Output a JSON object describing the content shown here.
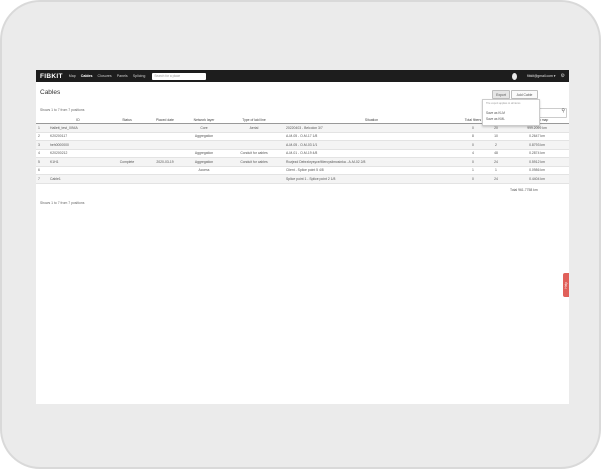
{
  "nav": {
    "logo": "FIBKIT",
    "items": [
      "Map",
      "Cables",
      "Closures",
      "Panels",
      "Splicing"
    ],
    "search_placeholder": "Search for a place",
    "user_email": "fibkit@gmail.com ▾"
  },
  "page": {
    "title": "Cables",
    "export_label": "Export",
    "add_label": "Add Cable",
    "export_menu": {
      "note": "The export applies to all items",
      "items": [
        "Save as KLM",
        "Save as KML"
      ]
    },
    "showing_top": "Shows 1 to 7 from 7 positions",
    "showing_bottom": "Shows 1 to 7 from 7 positions"
  },
  "table": {
    "columns": [
      "ID",
      "Status",
      "Placed date",
      "Network layer",
      "Type of laid line",
      "Situation",
      "Total fibers",
      "Fr",
      "Length on map"
    ],
    "rows": [
      {
        "n": "1",
        "id": "Hallett_test_XINIA",
        "status": "",
        "date": "",
        "layer": "Core",
        "line": "Aerial",
        "situation": "20220403 - Belcolon 3/7",
        "fibers": "0",
        "fr": "20",
        "length": "999.2099 km"
      },
      {
        "n": "2",
        "id": "K20200117",
        "status": "",
        "date": "",
        "layer": "Aggregation",
        "line": "",
        "situation": "A-M-05 - O-M-17 1/8",
        "fibers": "8",
        "fr": "10",
        "length": "0.2647 km"
      },
      {
        "n": "3",
        "id": "heh0000000",
        "status": "",
        "date": "",
        "layer": "",
        "line": "",
        "situation": "A-M-05 - O-M-03 1/1",
        "fibers": "0",
        "fr": "2",
        "length": "0.8793 km"
      },
      {
        "n": "4",
        "id": "K20200212",
        "status": "",
        "date": "",
        "layer": "Aggregation",
        "line": "Conduit for cables",
        "situation": "A-M-01 - O-M-19 4/8",
        "fibers": "4",
        "fr": "48",
        "length": "0.2874 km"
      },
      {
        "n": "5",
        "id": "K1H1",
        "status": "Complete",
        "date": "2020-03-19",
        "layer": "Aggregation",
        "line": "Conduit for cables",
        "situation": "Rozjezd Debrzkrysyce/Mercyslimosinka - A-M-02 2/8",
        "fibers": "0",
        "fr": "24",
        "length": "0.5912 km"
      },
      {
        "n": "6",
        "id": "",
        "status": "",
        "date": "",
        "layer": "Access",
        "line": "",
        "situation": "Client - Splice point 5 4/8",
        "fibers": "1",
        "fr": "1",
        "length": "0.0986 km"
      },
      {
        "n": "7",
        "id": "Cable1",
        "status": "",
        "date": "",
        "layer": "",
        "line": "",
        "situation": "Splice point 1 - Splice point 2 1/8",
        "fibers": "0",
        "fr": "24",
        "length": "0.4404 km"
      }
    ],
    "total": "Total 961.7758 km"
  },
  "help_label": "Help"
}
